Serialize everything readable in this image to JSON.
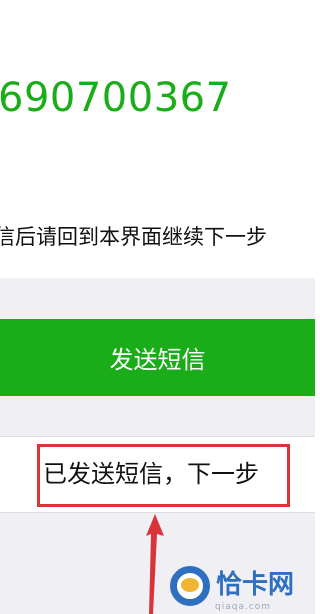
{
  "verify": {
    "phone_number": "690700367",
    "hint": "信后请回到本界面继续下一步"
  },
  "actions": {
    "send_sms_label": "发送短信",
    "sent_next_label": "已发送短信，下一步"
  },
  "watermark": {
    "site_name": "恰卡网",
    "site_url": "qiaqa.com"
  },
  "colors": {
    "brand_green": "#1aad19",
    "highlight_red": "#d9343a",
    "logo_blue": "#2e6fbf"
  },
  "icons": {
    "annotation": "arrow-up-icon",
    "watermark": "logo-icon"
  }
}
